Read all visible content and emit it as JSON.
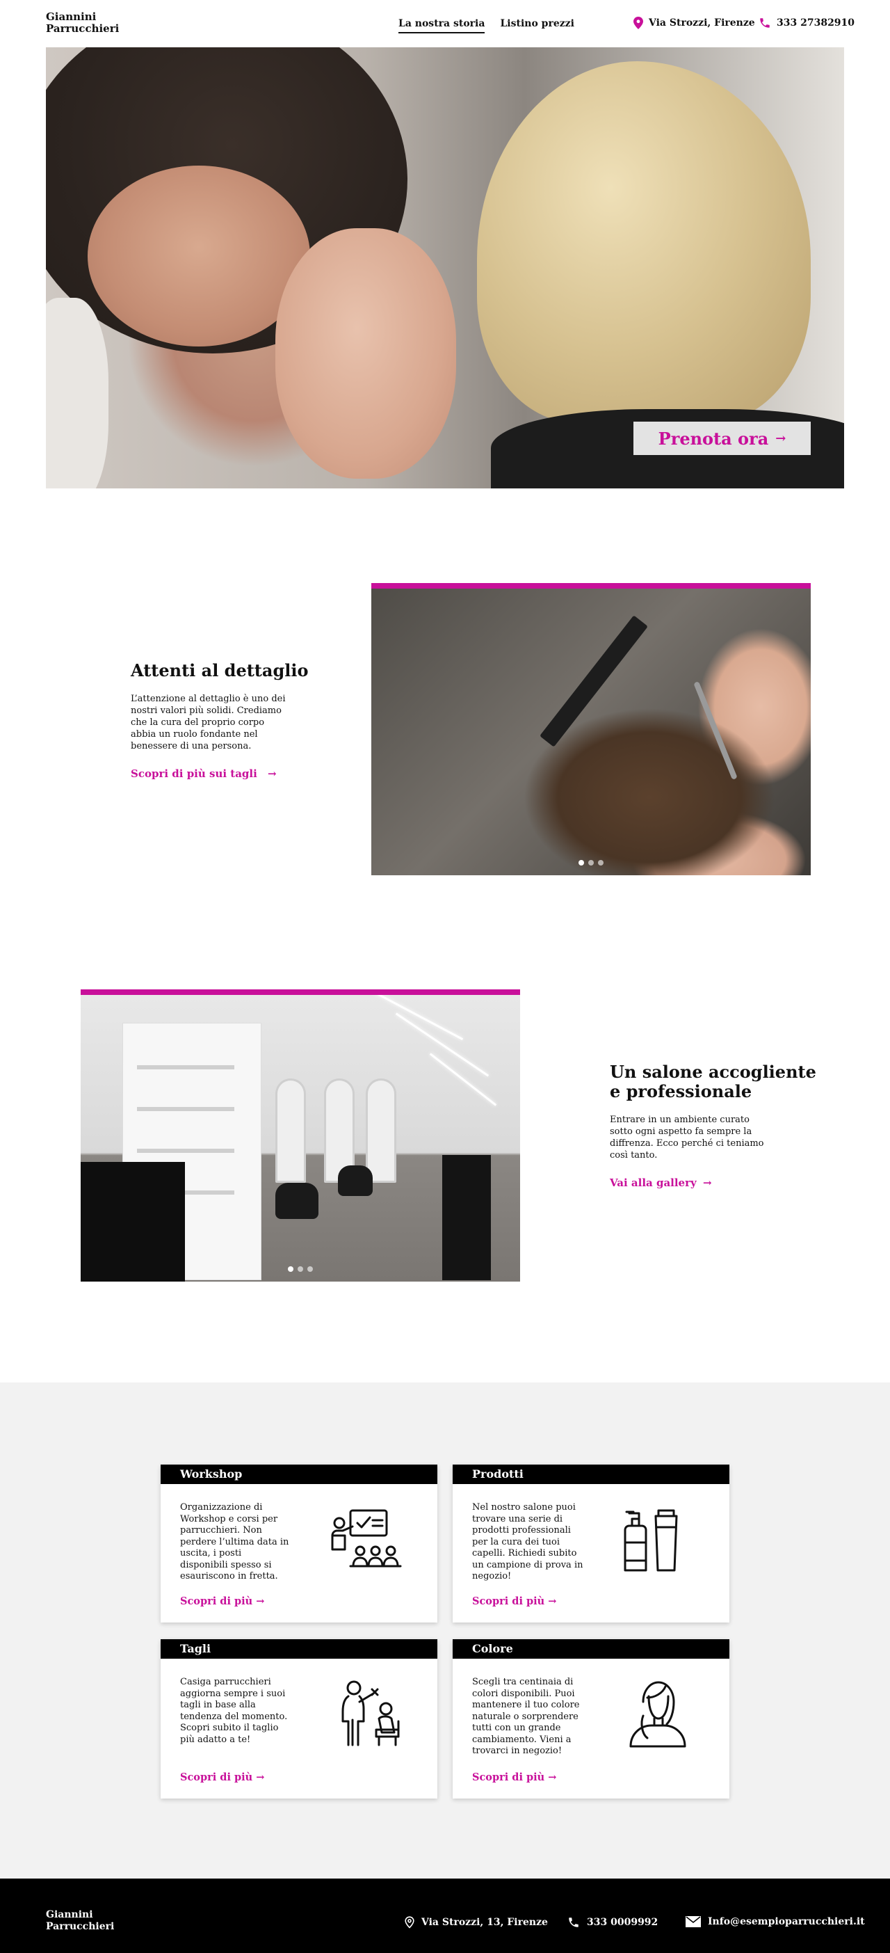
{
  "header": {
    "brand_line1": "Giannini",
    "brand_line2": "Parrucchieri",
    "nav": [
      {
        "label": "La nostra storia",
        "active": true
      },
      {
        "label": "Listino prezzi",
        "active": false
      }
    ],
    "address": "Via Strozzi, Firenze",
    "phone": "333 27382910"
  },
  "hero": {
    "cta_label": "Prenota ora",
    "cta_arrow": "→"
  },
  "features": [
    {
      "title": "Attenti al dettaglio",
      "body": "L’attenzione al dettaglio è uno dei nostri valori più solidi. Crediamo che la cura del proprio corpo abbia un ruolo fondante nel benessere di una persona.",
      "link": "Scopri di più sui tagli",
      "arrow": "→"
    },
    {
      "title_line1": "Un salone accogliente",
      "title_line2": "e professionale",
      "body": "Entrare in un ambiente curato sotto ogni aspetto fa sempre la diffrenza. Ecco perché ci teniamo così tanto.",
      "link": "Vai alla gallery",
      "arrow": "→"
    }
  ],
  "services": [
    {
      "title": "Workshop",
      "body": "Organizzazione di Workshop e corsi per parrucchieri. Non perdere l’ultima data in uscita, i posti disponibili spesso si esauriscono in fretta.",
      "link": "Scopri di più",
      "icon": "presentation-icon"
    },
    {
      "title": "Prodotti",
      "body": "Nel nostro salone puoi trovare una serie di prodotti professionali per la cura dei tuoi capelli. Richiedi subito un campione di prova in negozio!",
      "link": "Scopri di più",
      "icon": "bottles-icon"
    },
    {
      "title": "Tagli",
      "body": "Casiga parrucchieri aggiorna sempre i suoi tagli in base alla tendenza del momento. Scopri subito il taglio più adatto a te!",
      "link": "Scopri di più",
      "icon": "haircut-icon"
    },
    {
      "title": "Colore",
      "body": "Scegli tra centinaia di colori disponibili. Puoi mantenere il tuo colore naturale o sorprendere tutti con un grande cambiamento. Vieni a trovarci in negozio!",
      "link": "Scopri di più",
      "icon": "woman-hair-icon"
    }
  ],
  "service_arrow": "→",
  "footer": {
    "brand_line1": "Giannini",
    "brand_line2": "Parrucchieri",
    "address": "Via Strozzi, 13, Firenze",
    "phone": "333 0009992",
    "email": "Info@esempioparrucchieri.it"
  },
  "colors": {
    "accent": "#c8109a",
    "dark": "#000000",
    "section_bg": "#f2f2f2"
  }
}
